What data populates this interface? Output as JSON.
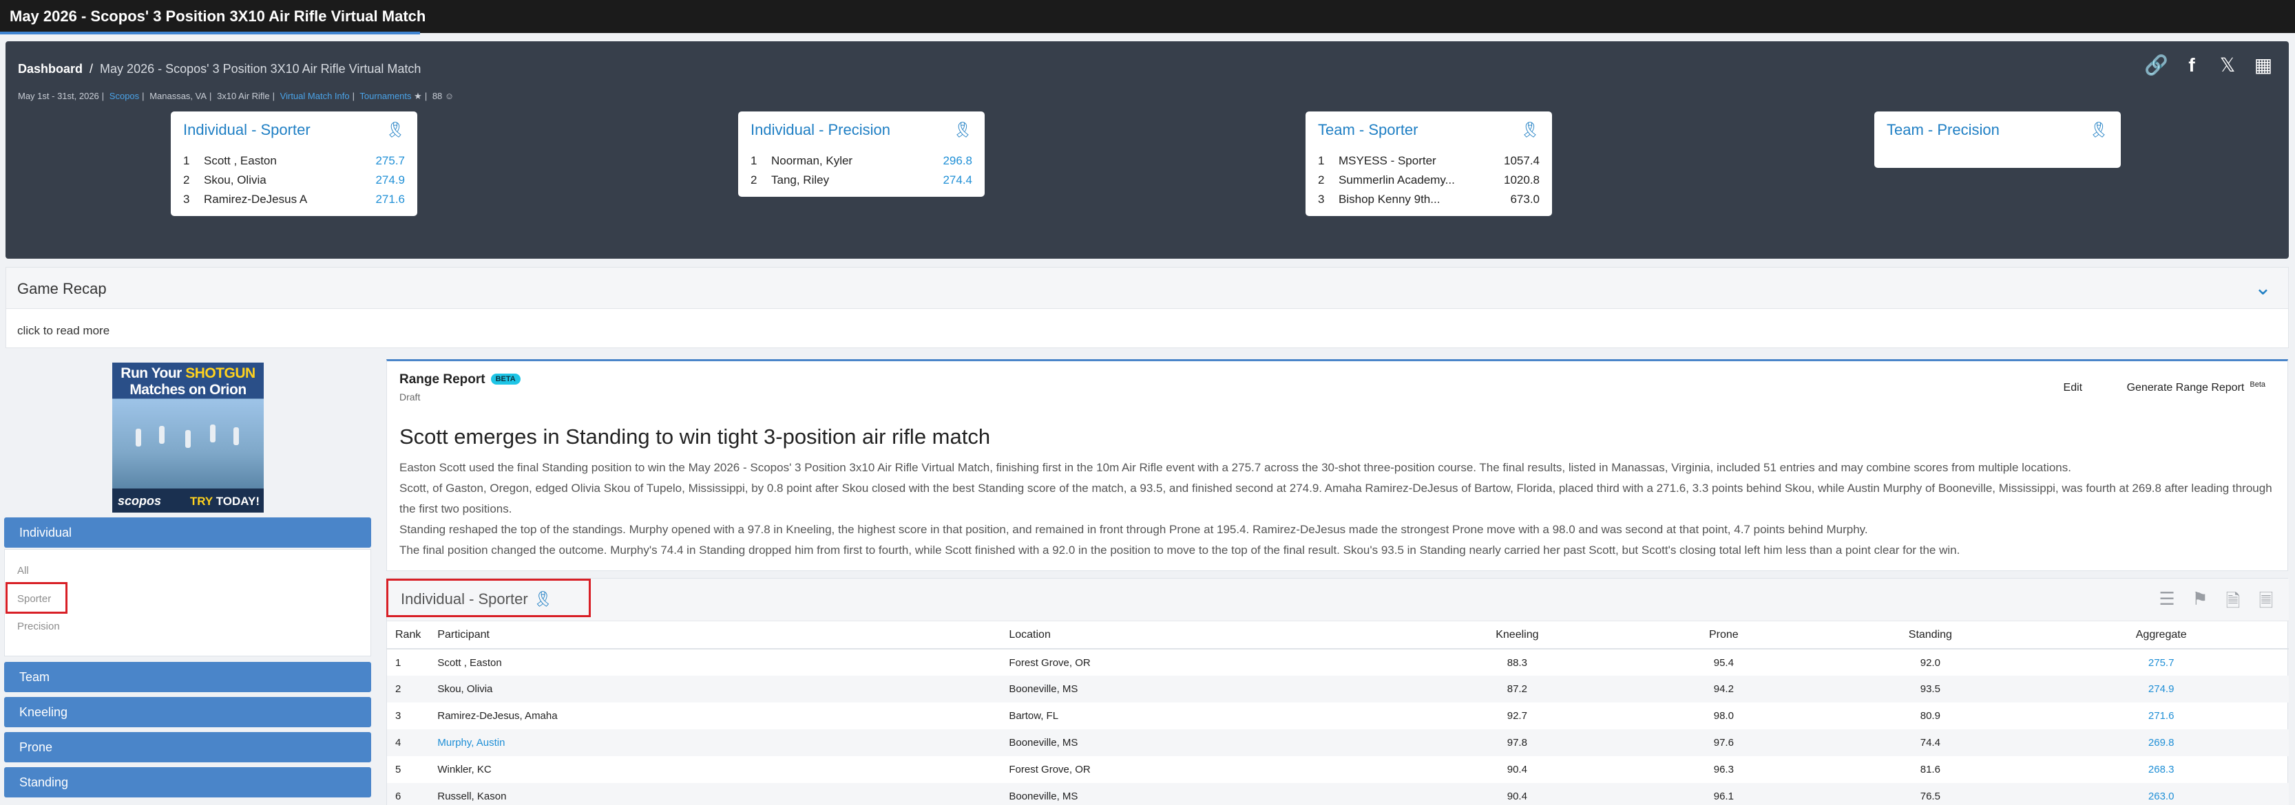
{
  "window": {
    "title": "May 2026 - Scopos' 3 Position 3X10 Air Rifle Virtual Match"
  },
  "breadcrumb": {
    "home": "Dashboard",
    "separator": "/",
    "current": "May 2026 - Scopos' 3 Position 3X10 Air Rifle Virtual Match"
  },
  "meta": {
    "dates": "May 1st - 31st, 2026",
    "org": "Scopos",
    "location": "Manassas, VA",
    "discipline": "3x10 Air Rifle",
    "virtual_info": "Virtual Match Info",
    "tournaments": "Tournaments",
    "count": "88"
  },
  "share_icons": [
    "link-icon",
    "facebook-icon",
    "x-icon",
    "qr-code-icon"
  ],
  "summary_cards": [
    {
      "title": "Individual - Sporter",
      "rows": [
        {
          "rank": "1",
          "name": "Scott , Easton",
          "score": "275.7"
        },
        {
          "rank": "2",
          "name": "Skou, Olivia",
          "score": "274.9"
        },
        {
          "rank": "3",
          "name": "Ramirez-DeJesus A",
          "score": "271.6"
        }
      ]
    },
    {
      "title": "Individual - Precision",
      "rows": [
        {
          "rank": "1",
          "name": "Noorman, Kyler",
          "score": "296.8"
        },
        {
          "rank": "2",
          "name": "Tang, Riley",
          "score": "274.4"
        }
      ]
    },
    {
      "title": "Team - Sporter",
      "rows": [
        {
          "rank": "1",
          "name": "MSYESS - Sporter",
          "score": "1057.4"
        },
        {
          "rank": "2",
          "name": "Summerlin Academy...",
          "score": "1020.8"
        },
        {
          "rank": "3",
          "name": "Bishop Kenny 9th...",
          "score": "673.0"
        }
      ]
    },
    {
      "title": "Team - Precision",
      "rows": []
    }
  ],
  "recap": {
    "title": "Game Recap",
    "read_more": "click to read more"
  },
  "ad": {
    "line1a": "Run Your",
    "line1b": "SHOTGUN",
    "line2": "Matches on Orion",
    "logo": "scopos",
    "cta_a": "TRY",
    "cta_b": "TODAY!"
  },
  "sidebar": {
    "individual": "Individual",
    "sub_items": [
      "All",
      "Sporter",
      "Precision"
    ],
    "team": "Team",
    "kneeling": "Kneeling",
    "prone": "Prone",
    "standing": "Standing"
  },
  "report": {
    "title": "Range Report",
    "beta": "BETA",
    "status": "Draft",
    "edit": "Edit",
    "generate": "Generate Range Report",
    "generate_badge": "Beta",
    "headline": "Scott emerges in Standing to win tight 3-position air rifle match",
    "paragraphs": [
      "Easton Scott used the final Standing position to win the May 2026 - Scopos' 3 Position 3x10 Air Rifle Virtual Match, finishing first in the 10m Air Rifle event with a 275.7 across the 30-shot three-position course. The final results, listed in Manassas, Virginia, included 51 entries and may combine scores from multiple locations.",
      "Scott, of Gaston, Oregon, edged Olivia Skou of Tupelo, Mississippi, by 0.8 point after Skou closed with the best Standing score of the match, a 93.5, and finished second at 274.9. Amaha Ramirez-DeJesus of Bartow, Florida, placed third with a 271.6, 3.3 points behind Skou, while Austin Murphy of Booneville, Mississippi, was fourth at 269.8 after leading through the first two positions.",
      "Standing reshaped the top of the standings. Murphy opened with a 97.8 in Kneeling, the highest score in that position, and remained in front through Prone at 195.4. Ramirez-DeJesus made the strongest Prone move with a 98.0 and was second at that point, 4.7 points behind Murphy.",
      "The final position changed the outcome. Murphy's 74.4 in Standing dropped him from first to fourth, while Scott finished with a 92.0 in the position to move to the top of the final result. Skou's 93.5 in Standing nearly carried her past Scott, but Scott's closing total left him less than a point clear for the win."
    ]
  },
  "results": {
    "title": "Individual - Sporter",
    "tool_icons": [
      "layers-add-icon",
      "flag-icon",
      "excel-export-icon",
      "pdf-export-icon"
    ],
    "columns": [
      "Rank",
      "Participant",
      "Location",
      "Kneeling",
      "Prone",
      "Standing",
      "Aggregate"
    ],
    "rows": [
      {
        "rank": "1",
        "name": "Scott , Easton",
        "location": "Forest Grove, OR",
        "kneeling": "88.3",
        "prone": "95.4",
        "standing": "92.0",
        "aggregate": "275.7",
        "link": false
      },
      {
        "rank": "2",
        "name": "Skou, Olivia",
        "location": "Booneville, MS",
        "kneeling": "87.2",
        "prone": "94.2",
        "standing": "93.5",
        "aggregate": "274.9",
        "link": false
      },
      {
        "rank": "3",
        "name": "Ramirez-DeJesus, Amaha",
        "location": "Bartow, FL",
        "kneeling": "92.7",
        "prone": "98.0",
        "standing": "80.9",
        "aggregate": "271.6",
        "link": false
      },
      {
        "rank": "4",
        "name": "Murphy, Austin",
        "location": "Booneville, MS",
        "kneeling": "97.8",
        "prone": "97.6",
        "standing": "74.4",
        "aggregate": "269.8",
        "link": true
      },
      {
        "rank": "5",
        "name": "Winkler, KC",
        "location": "Forest Grove, OR",
        "kneeling": "90.4",
        "prone": "96.3",
        "standing": "81.6",
        "aggregate": "268.3",
        "link": false
      },
      {
        "rank": "6",
        "name": "Russell, Kason",
        "location": "Booneville, MS",
        "kneeling": "90.4",
        "prone": "96.1",
        "standing": "76.5",
        "aggregate": "263.0",
        "link": false
      }
    ]
  },
  "colors": {
    "accent": "#1f7fc4",
    "nav": "#4a85c9",
    "highlight": "#d81f26",
    "beta": "#1ec5e6"
  }
}
